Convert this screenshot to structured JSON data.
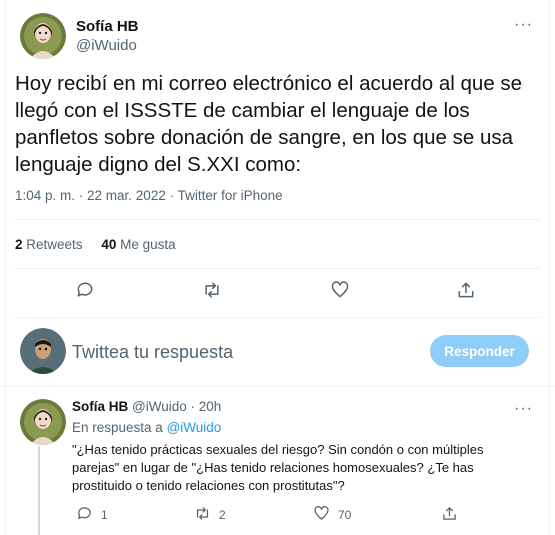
{
  "tweet": {
    "author_name": "Sofía HB",
    "author_handle": "@iWuido",
    "text": "Hoy recibí en mi correo electrónico el acuerdo al que se llegó con el ISSSTE de cambiar el lenguaje de los panfletos sobre donación de sangre, en los que se usa lenguaje digno del S.XXI como:",
    "meta": "1:04 p. m. · 22 mar. 2022 · Twitter for iPhone",
    "retweets_count": "2",
    "retweets_label": "Retweets",
    "likes_count": "40",
    "likes_label": "Me gusta",
    "more_glyph": "···"
  },
  "composer": {
    "placeholder": "Twittea tu respuesta",
    "button_label": "Responder"
  },
  "reply": {
    "author_name": "Sofía HB",
    "author_handle": "@iWuido",
    "time": "· 20h",
    "reply_prefix": "En respuesta a",
    "reply_to_handle": "@iWuido",
    "text": "\"¿Has tenido prácticas sexuales del riesgo? Sin condón o con múltiples parejas\" en lugar de \"¿Has tenido relaciones homosexuales? ¿Te has prostituido o tenido relaciones con prostitutas\"?",
    "replies_count": "1",
    "retweets_count": "2",
    "likes_count": "70",
    "more_glyph": "···"
  },
  "colors": {
    "accent": "#1d9bf0",
    "button_disabled": "#8ecdf8",
    "secondary_text": "#536471"
  }
}
